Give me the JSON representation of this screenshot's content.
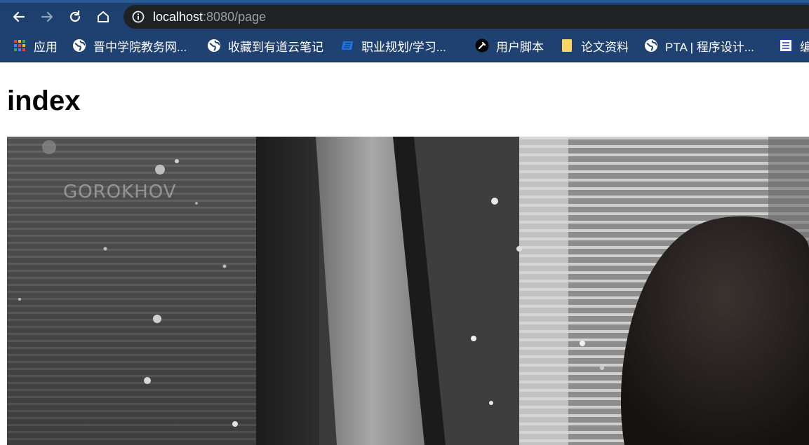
{
  "browser": {
    "url_host": "localhost",
    "url_rest": ":8080/page",
    "bookmarks": [
      {
        "label": "应用",
        "icon": "apps-grid-icon"
      },
      {
        "label": "晋中学院教务网...",
        "icon": "globe-icon"
      },
      {
        "label": "收藏到有道云笔记",
        "icon": "globe-icon"
      },
      {
        "label": "职业规划/学习...",
        "icon": "blue-doc-icon"
      },
      {
        "label": "用户脚本",
        "icon": "script-icon"
      },
      {
        "label": "论文资料",
        "icon": "folder-icon"
      },
      {
        "label": "PTA | 程序设计...",
        "icon": "globe-icon"
      },
      {
        "label": "编",
        "icon": "edit-icon"
      }
    ]
  },
  "page": {
    "title": "index",
    "photo_watermark": "GOROKHOV"
  }
}
